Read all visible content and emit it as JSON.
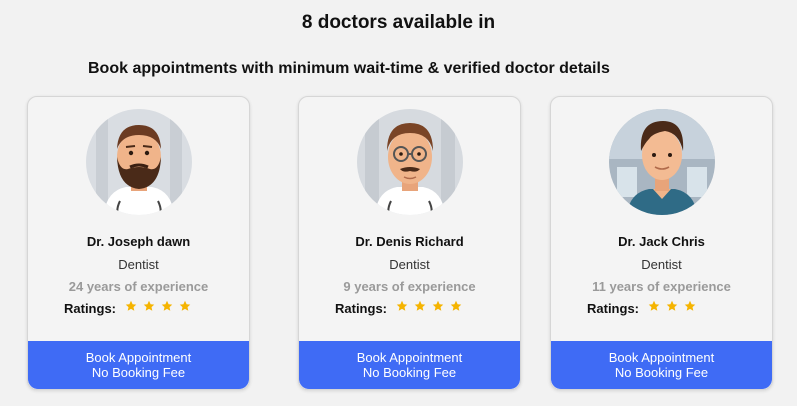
{
  "header": {
    "title": "8 doctors available in",
    "subtitle": "Book appointments with minimum wait-time & verified doctor details"
  },
  "doctors": [
    {
      "name": "Dr. Joseph dawn",
      "specialty": "Dentist",
      "experience": "24 years of experience",
      "ratings_label": "Ratings:",
      "rating": 4,
      "button_line1": "Book Appointment",
      "button_line2": "No Booking Fee"
    },
    {
      "name": "Dr. Denis Richard",
      "specialty": "Dentist",
      "experience": "9 years of experience",
      "ratings_label": "Ratings:",
      "rating": 4,
      "button_line1": "Book Appointment",
      "button_line2": "No Booking Fee"
    },
    {
      "name": "Dr. Jack Chris",
      "specialty": "Dentist",
      "experience": "11 years of experience",
      "ratings_label": "Ratings:",
      "rating": 3,
      "button_line1": "Book Appointment",
      "button_line2": "No Booking Fee"
    }
  ],
  "colors": {
    "accent": "#3f6bf5",
    "star": "#f5b400",
    "muted_text": "#9a9a9a"
  },
  "icons": {
    "star": "star-icon",
    "avatar": "doctor-avatar"
  }
}
